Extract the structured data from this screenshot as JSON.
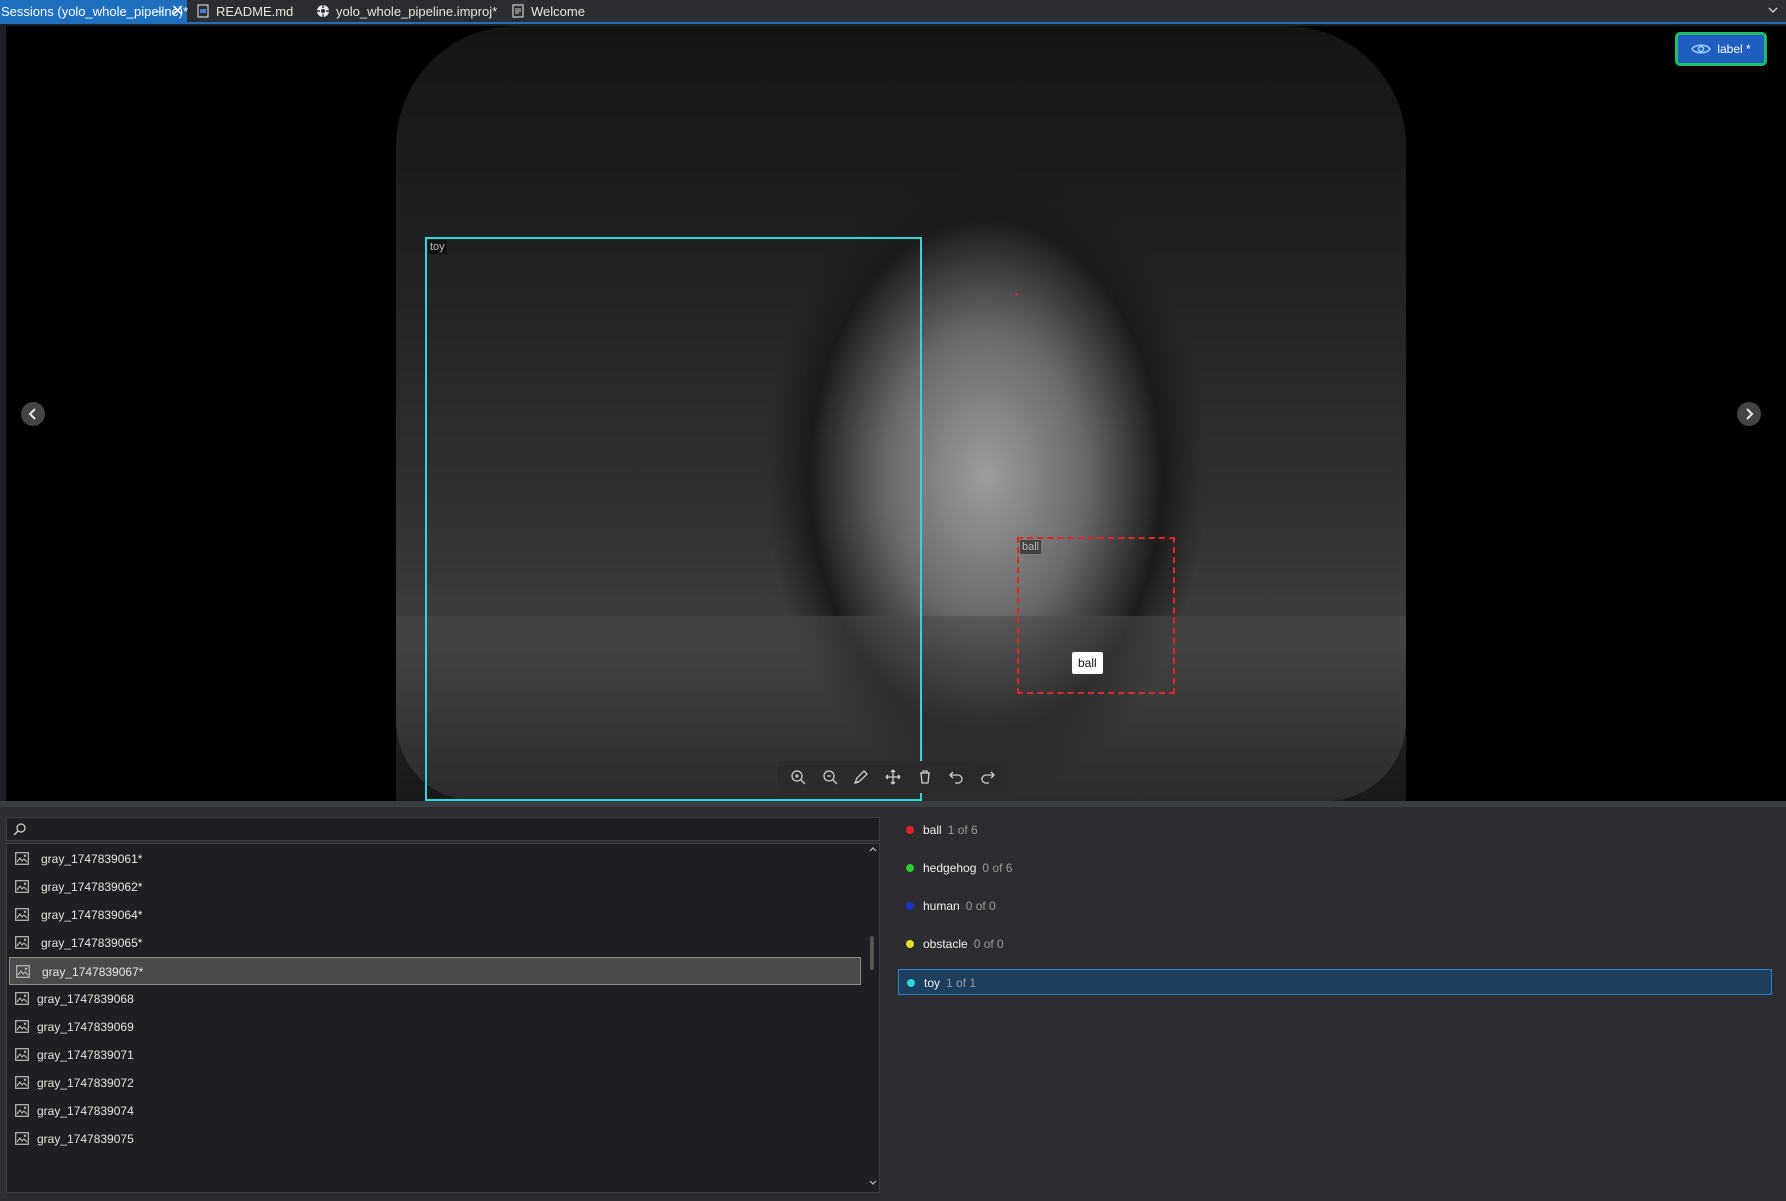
{
  "tabs": [
    {
      "label": "Sessions (yolo_whole_pipeline)*",
      "active": true,
      "icon": "sessions-icon"
    },
    {
      "label": "README.md",
      "active": false,
      "icon": "markdown-file-icon"
    },
    {
      "label": "yolo_whole_pipeline.improj*",
      "active": false,
      "icon": "project-file-icon"
    },
    {
      "label": "Welcome",
      "active": false,
      "icon": "document-icon"
    }
  ],
  "viewer": {
    "label_toggle": "label *",
    "annotations": [
      {
        "name": "toy",
        "color": "#2fd4dc",
        "style": "solid"
      },
      {
        "name": "ball",
        "color": "#e0242a",
        "style": "dashed"
      }
    ],
    "popup_label": "ball",
    "tools": [
      "zoom-in-icon",
      "zoom-out-icon",
      "draw-polygon-icon",
      "move-icon",
      "delete-icon",
      "undo-icon",
      "redo-icon"
    ]
  },
  "search": {
    "placeholder": "",
    "value": ""
  },
  "files": [
    {
      "name": "gray_1747839061*",
      "modified": true
    },
    {
      "name": "gray_1747839062*",
      "modified": true
    },
    {
      "name": "gray_1747839064*",
      "modified": true
    },
    {
      "name": "gray_1747839065*",
      "modified": true
    },
    {
      "name": "gray_1747839067*",
      "modified": true,
      "selected": true
    },
    {
      "name": "gray_1747839068",
      "modified": false
    },
    {
      "name": "gray_1747839069",
      "modified": false
    },
    {
      "name": "gray_1747839071",
      "modified": false
    },
    {
      "name": "gray_1747839072",
      "modified": false
    },
    {
      "name": "gray_1747839074",
      "modified": false
    },
    {
      "name": "gray_1747839075",
      "modified": false
    }
  ],
  "labels": [
    {
      "name": "ball",
      "count": "1 of 6",
      "color": "#e0242a"
    },
    {
      "name": "hedgehog",
      "count": "0 of 6",
      "color": "#2ecc2e"
    },
    {
      "name": "human",
      "count": "0 of 0",
      "color": "#2030c8"
    },
    {
      "name": "obstacle",
      "count": "0 of 0",
      "color": "#e6e028"
    },
    {
      "name": "toy",
      "count": "1 of 1",
      "color": "#2fd4dc",
      "selected": true
    }
  ]
}
